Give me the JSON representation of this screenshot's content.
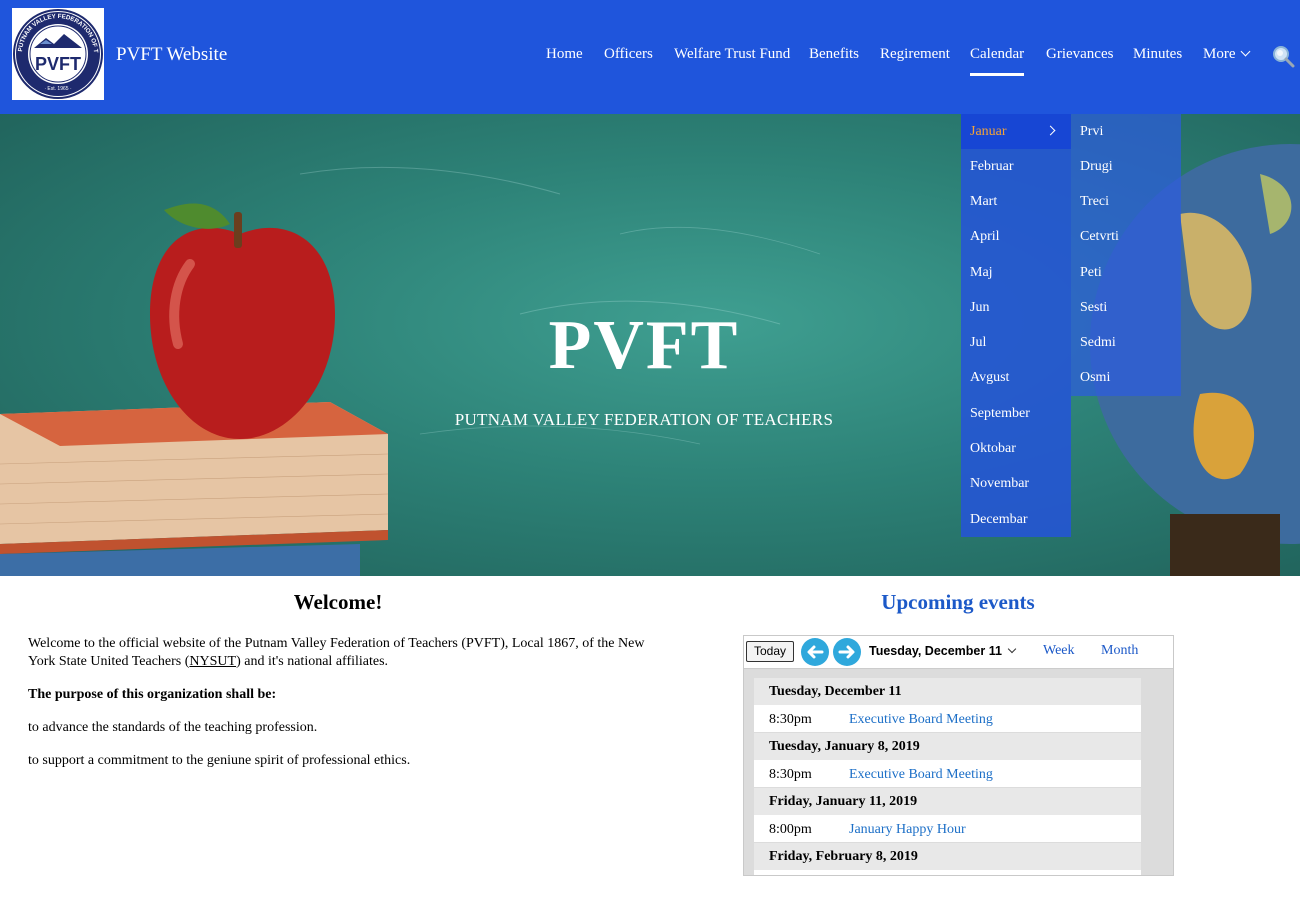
{
  "header": {
    "logo": {
      "ring_text": "PUTNAM VALLEY FEDERATION OF TEACHERS",
      "center_text": "PVFT",
      "est_text": "Est. 1965"
    },
    "site_title": "PVFT Website",
    "nav": [
      {
        "label": "Home"
      },
      {
        "label": "Officers"
      },
      {
        "label": "Welfare Trust Fund"
      },
      {
        "label": "Benefits"
      },
      {
        "label": "Regirement"
      },
      {
        "label": "Calendar",
        "active": true
      },
      {
        "label": "Grievances"
      },
      {
        "label": "Minutes"
      },
      {
        "label": "More"
      }
    ],
    "search_icon": "search-icon"
  },
  "hero": {
    "title": "PVFT",
    "subtitle": "PUTNAM VALLEY FEDERATION OF TEACHERS"
  },
  "calendar_menu": {
    "months": [
      "Januar",
      "Februar",
      "Mart",
      "April",
      "Maj",
      "Jun",
      "Jul",
      "Avgust",
      "September",
      "Oktobar",
      "Novembar",
      "Decembar"
    ],
    "active_month": "Januar",
    "submenu": [
      "Prvi",
      "Drugi",
      "Treci",
      "Cetvrti",
      "Peti",
      "Sesti",
      "Sedmi",
      "Osmi"
    ]
  },
  "welcome": {
    "heading": "Welcome!",
    "intro_before": "Welcome to the official website of the Putnam Valley Federation of Teachers (PVFT), Local 1867, of the New York State United Teachers (",
    "intro_link": "NYSUT",
    "intro_after": ") and it's national affiliates.",
    "purpose_heading": "The purpose of this organization shall be:",
    "purpose_1": "to advance the standards of the teaching profession.",
    "purpose_2": "to support a commitment to the geniune spirit of professional ethics."
  },
  "events": {
    "heading": "Upcoming events",
    "toolbar": {
      "today_label": "Today",
      "current_date": "Tuesday, December 11",
      "week_label": "Week",
      "month_label": "Month"
    },
    "days": [
      {
        "date": "Tuesday, December 11",
        "events": [
          {
            "time": "8:30pm",
            "title": "Executive Board Meeting"
          }
        ]
      },
      {
        "date": "Tuesday, January 8, 2019",
        "events": [
          {
            "time": "8:30pm",
            "title": "Executive Board Meeting"
          }
        ]
      },
      {
        "date": "Friday, January 11, 2019",
        "events": [
          {
            "time": "8:00pm",
            "title": "January Happy Hour"
          }
        ]
      },
      {
        "date": "Friday, February 8, 2019",
        "events": []
      }
    ]
  }
}
